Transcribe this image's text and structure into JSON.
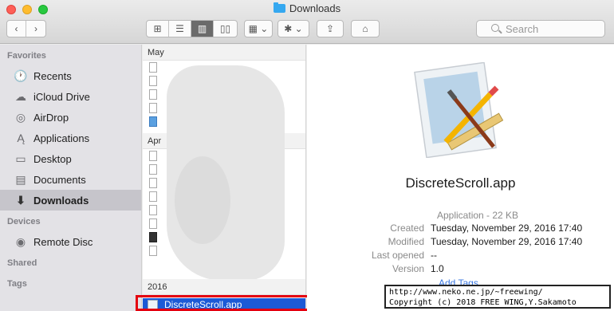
{
  "window": {
    "title": "Downloads"
  },
  "toolbar": {
    "back_glyph": "‹",
    "forward_glyph": "›",
    "view_icons": "⊞",
    "view_list": "☰",
    "view_columns": "▥",
    "view_coverflow": "▯▯",
    "arrange_glyph": "▦ ⌄",
    "action_glyph": "✱ ⌄",
    "share_glyph": "⇪",
    "tag_glyph": "⌂",
    "search_placeholder": "Search"
  },
  "sidebar": {
    "favorites_label": "Favorites",
    "items": [
      {
        "label": "Recents",
        "icon": "clock-icon",
        "glyph": "🕐"
      },
      {
        "label": "iCloud Drive",
        "icon": "cloud-icon",
        "glyph": "☁"
      },
      {
        "label": "AirDrop",
        "icon": "airdrop-icon",
        "glyph": "◎"
      },
      {
        "label": "Applications",
        "icon": "applications-icon",
        "glyph": "Ą"
      },
      {
        "label": "Desktop",
        "icon": "desktop-icon",
        "glyph": "▭"
      },
      {
        "label": "Documents",
        "icon": "documents-icon",
        "glyph": "▤"
      },
      {
        "label": "Downloads",
        "icon": "downloads-icon",
        "glyph": "⬇"
      }
    ],
    "devices_label": "Devices",
    "devices": [
      {
        "label": "Remote Disc",
        "icon": "disc-icon",
        "glyph": "◉"
      }
    ],
    "shared_label": "Shared",
    "tags_label": "Tags"
  },
  "browser": {
    "groups": [
      "May",
      "Apr",
      "2016"
    ],
    "selected_file": "DiscreteScroll.app"
  },
  "preview": {
    "name": "DiscreteScroll.app",
    "kind": "Application - 22 KB",
    "rows": [
      {
        "key": "Created",
        "value": "Tuesday, November 29, 2016 17:40"
      },
      {
        "key": "Modified",
        "value": "Tuesday, November 29, 2016 17:40"
      },
      {
        "key": "Last opened",
        "value": "--"
      },
      {
        "key": "Version",
        "value": "1.0"
      }
    ],
    "add_tags": "Add Tags..."
  },
  "overlay": {
    "line1": "http://www.neko.ne.jp/~freewing/",
    "line2": "Copyright (c) 2018 FREE WING,Y.Sakamoto"
  },
  "colors": {
    "selection": "#1c5ad6",
    "highlight_box": "#e4000f"
  }
}
